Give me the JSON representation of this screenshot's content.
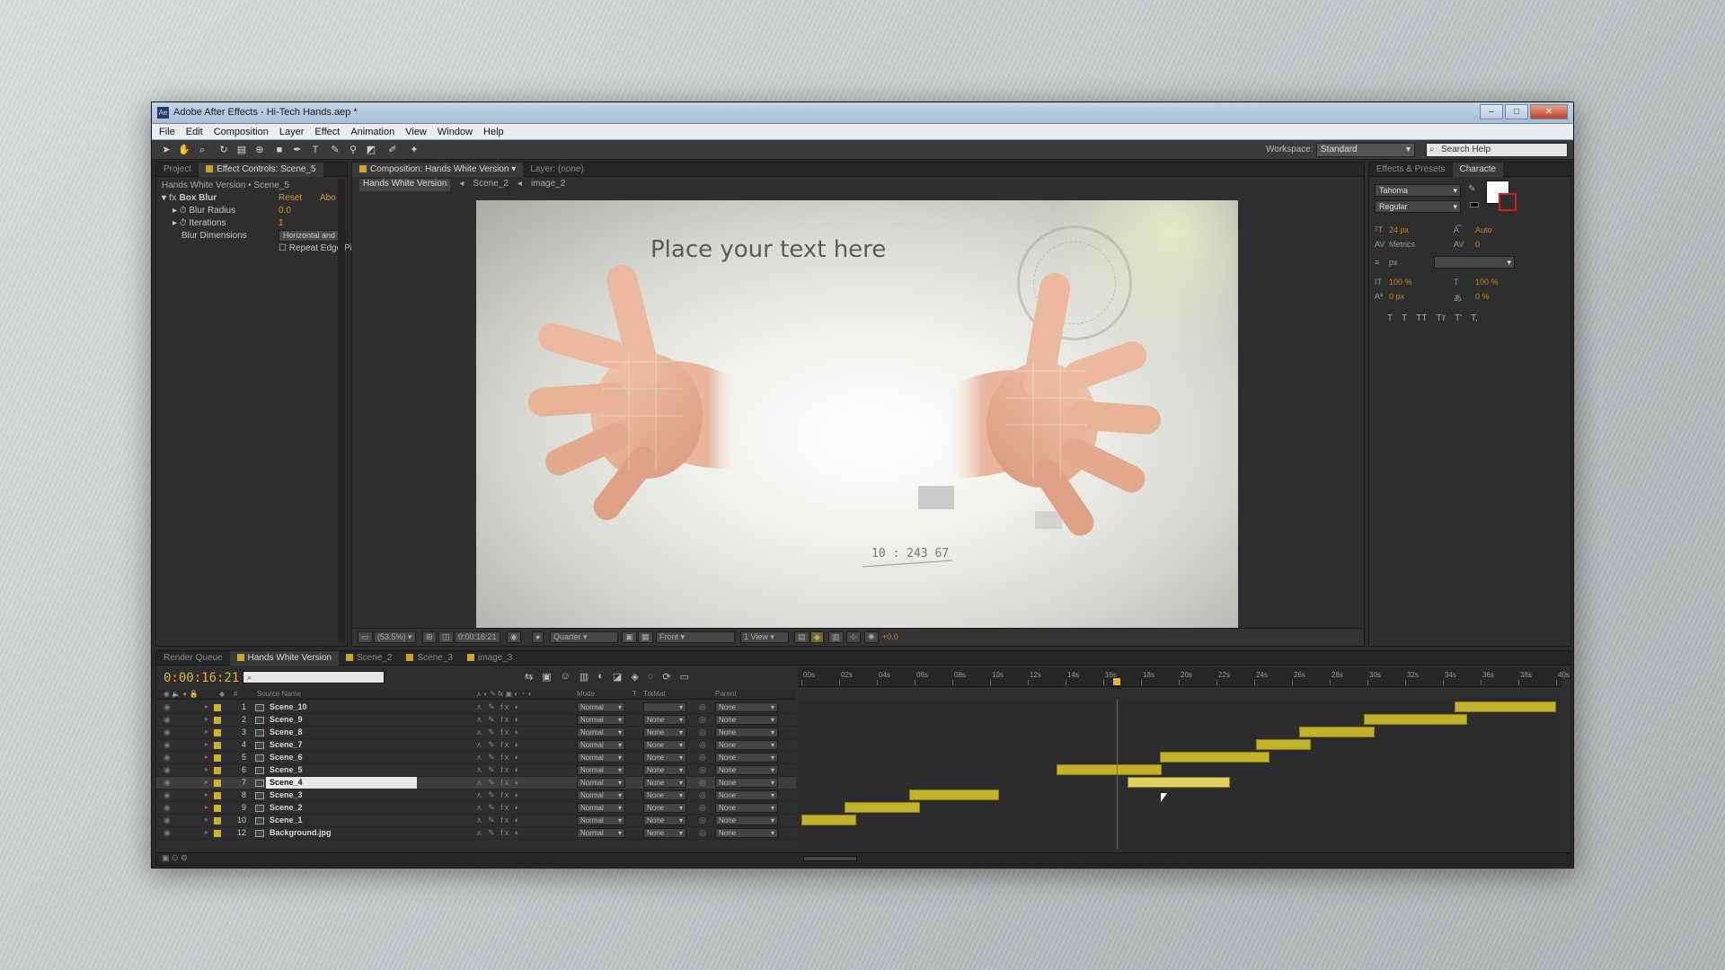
{
  "window": {
    "title": "Adobe After Effects - Hi-Tech Hands.aep *",
    "app_icon": "Ae",
    "buttons": [
      "–",
      "□",
      "✕"
    ]
  },
  "menu": [
    "File",
    "Edit",
    "Composition",
    "Layer",
    "Effect",
    "Animation",
    "View",
    "Window",
    "Help"
  ],
  "toolbar": {
    "workspace_label": "Workspace:",
    "workspace_value": "Standard",
    "search_placeholder": "Search Help"
  },
  "effect_panel": {
    "tabs": [
      "Project",
      "Effect Controls: Scene_5"
    ],
    "breadcrumb": "Hands White Version • Scene_5",
    "effect_name": "Box Blur",
    "reset": "Reset",
    "about": "Abo",
    "props": {
      "blur_radius_label": "Blur Radius",
      "blur_radius_value": "0.0",
      "iterations_label": "Iterations",
      "iterations_value": "1",
      "blur_dimensions_label": "Blur Dimensions",
      "blur_dimensions_value": "Horizontal and",
      "repeat_edge_label": "Repeat Edge Pixels"
    }
  },
  "comp_panel": {
    "tabs": [
      "Composition: Hands White Version",
      "Layer: (none)"
    ],
    "nav": [
      "Hands White Version",
      "Scene_2",
      "image_2"
    ],
    "canvas_text": "Place your text here",
    "readout": "10 : 243 67",
    "footer": {
      "zoom": "(53.5%)",
      "timecode": "0:00:16:21",
      "resolution": "Quarter",
      "view": "Front",
      "views": "1 View",
      "exposure": "+0.0"
    }
  },
  "character_panel": {
    "tabs": [
      "Effects & Presets",
      "Characte"
    ],
    "font": "Tahoma",
    "style": "Regular",
    "size": "24 px",
    "leading": "Auto",
    "kerning": "Metrics",
    "tracking": "0",
    "stroke_unit": "px",
    "vscale": "100 %",
    "hscale": "100 %",
    "baseline": "0 px",
    "tsume": "0 %",
    "styles": [
      "T",
      "T",
      "TT",
      "Tт",
      "T'",
      "T,"
    ]
  },
  "timeline": {
    "tabs": [
      "Render Queue",
      "Hands White Version",
      "Scene_2",
      "Scene_3",
      "image_3"
    ],
    "timecode": "0:00:16:21",
    "search_placeholder": "",
    "columns": {
      "num": "#",
      "source": "Source Name",
      "mode": "Mode",
      "t": "T",
      "trkmat": "TrkMat",
      "parent": "Parent"
    },
    "ruler": [
      "00s",
      "02s",
      "04s",
      "06s",
      "08s",
      "10s",
      "12s",
      "14s",
      "16s",
      "18s",
      "20s",
      "22s",
      "24s",
      "26s",
      "28s",
      "30s",
      "32s",
      "34s",
      "36s",
      "38s",
      "40s"
    ],
    "duration_seconds": 40,
    "current_time_seconds": 16.7,
    "layers": [
      {
        "num": "1",
        "name": "Scene_10",
        "mode": "Normal",
        "trkmat": "",
        "parent": "None",
        "start": 34.6,
        "end": 40.0
      },
      {
        "num": "2",
        "name": "Scene_9",
        "mode": "Normal",
        "trkmat": "None",
        "parent": "None",
        "start": 29.8,
        "end": 35.3
      },
      {
        "num": "3",
        "name": "Scene_8",
        "mode": "Normal",
        "trkmat": "None",
        "parent": "None",
        "start": 26.4,
        "end": 30.4
      },
      {
        "num": "4",
        "name": "Scene_7",
        "mode": "Normal",
        "trkmat": "None",
        "parent": "None",
        "start": 24.1,
        "end": 27.0
      },
      {
        "num": "5",
        "name": "Scene_6",
        "mode": "Normal",
        "trkmat": "None",
        "parent": "None",
        "start": 19.0,
        "end": 24.8
      },
      {
        "num": "6",
        "name": "Scene_5",
        "mode": "Normal",
        "trkmat": "None",
        "parent": "None",
        "start": 13.5,
        "end": 19.1
      },
      {
        "num": "7",
        "name": "Scene_4",
        "mode": "Normal",
        "trkmat": "None",
        "parent": "None",
        "start": 17.3,
        "end": 22.7,
        "selected": true
      },
      {
        "num": "8",
        "name": "Scene_3",
        "mode": "Normal",
        "trkmat": "None",
        "parent": "None",
        "start": 5.7,
        "end": 10.5
      },
      {
        "num": "9",
        "name": "Scene_2",
        "mode": "Normal",
        "trkmat": "None",
        "parent": "None",
        "start": 2.3,
        "end": 6.3
      },
      {
        "num": "10",
        "name": "Scene_1",
        "mode": "Normal",
        "trkmat": "None",
        "parent": "None",
        "start": 0.0,
        "end": 2.9
      },
      {
        "num": "12",
        "name": "Background.jpg",
        "mode": "Normal",
        "trkmat": "None",
        "parent": "None",
        "start": null,
        "end": null
      }
    ]
  }
}
